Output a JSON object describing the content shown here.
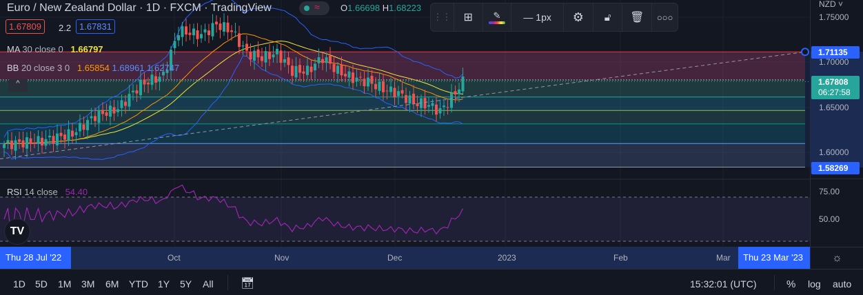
{
  "header": {
    "title": "Euro / New Zealand Dollar · 1D · FXCM · TradingView",
    "ohlc": {
      "o_label": "O",
      "o": "1.66698",
      "h_label": "H",
      "h": "1.68223"
    },
    "sell_price": "1.67809",
    "spread": "2.2",
    "buy_price": "1.67831"
  },
  "indicators": {
    "ma": {
      "name": "MA",
      "params": "30 close 0",
      "value": "1.66797",
      "color": "#f2e43a"
    },
    "bb": {
      "name": "BB",
      "params": "20 close 3 0",
      "basis": "1.65854",
      "upper": "1.68961",
      "lower": "1.62747"
    },
    "rsi": {
      "name": "RSI",
      "params": "14 close",
      "value": "54.40"
    }
  },
  "drawing_toolbar": {
    "width_label": "1px",
    "icons": [
      "drag-handle-icon",
      "add-template-icon",
      "pencil-color-icon",
      "line-width-icon",
      "gear-icon",
      "unlock-icon",
      "trash-icon",
      "more-icon"
    ]
  },
  "price_axis": {
    "currency": "NZD",
    "ticks": [
      "1.75000",
      "1.70000",
      "1.65000",
      "1.60000"
    ],
    "top_label": "1.71135",
    "bottom_label": "1.58269",
    "last_price": "1.67808",
    "countdown": "06:27:58"
  },
  "rsi_axis": {
    "ticks": [
      "75.00",
      "50.00"
    ]
  },
  "time_axis": {
    "start_label": "Thu 28 Jul '22",
    "end_label": "Thu 23 Mar '23",
    "ticks": [
      "Oct",
      "Nov",
      "Dec",
      "2023",
      "Feb",
      "Mar"
    ]
  },
  "bottom_bar": {
    "ranges": [
      "1D",
      "5D",
      "1M",
      "3M",
      "6M",
      "YTD",
      "1Y",
      "5Y",
      "All"
    ],
    "clock": "15:32:01 (UTC)",
    "percent": "%",
    "log": "log",
    "auto": "auto"
  },
  "colors": {
    "up": "#26a69a",
    "down": "#ef5350",
    "accent": "#2962ff",
    "rsi": "#9c27b0",
    "bb_basis": "#ff9800",
    "bb_band": "#2962ff"
  },
  "chart_data": {
    "type": "candlestick",
    "symbol": "EURNZD",
    "interval": "1D",
    "close_keypoints": [
      [
        0,
        1.608
      ],
      [
        10,
        1.612
      ],
      [
        18,
        1.62
      ],
      [
        24,
        1.64
      ],
      [
        30,
        1.648
      ],
      [
        36,
        1.675
      ],
      [
        42,
        1.685
      ],
      [
        46,
        1.735
      ],
      [
        52,
        1.73
      ],
      [
        56,
        1.742
      ],
      [
        60,
        1.735
      ],
      [
        64,
        1.71
      ],
      [
        68,
        1.705
      ],
      [
        72,
        1.71
      ],
      [
        76,
        1.69
      ],
      [
        80,
        1.69
      ],
      [
        84,
        1.705
      ],
      [
        88,
        1.69
      ],
      [
        92,
        1.682
      ],
      [
        96,
        1.678
      ],
      [
        100,
        1.67
      ],
      [
        104,
        1.665
      ],
      [
        108,
        1.655
      ],
      [
        112,
        1.652
      ],
      [
        115,
        1.645
      ],
      [
        118,
        1.66
      ],
      [
        121,
        1.678
      ]
    ],
    "fib_levels": [
      1.71135,
      1.68,
      1.661,
      1.646,
      1.631,
      1.609,
      1.58269
    ],
    "rsi_levels": [
      70,
      30
    ]
  }
}
